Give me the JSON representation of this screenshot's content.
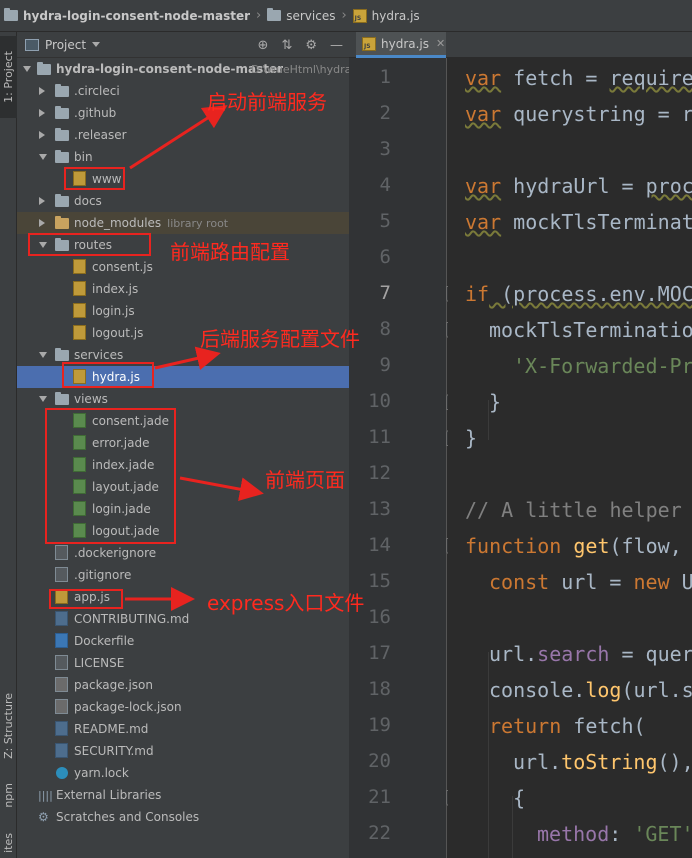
{
  "navbar": {
    "project": "hydra-login-consent-node-master",
    "folder": "services",
    "file": "hydra.js"
  },
  "left_strip": {
    "project_tab": "1: Project",
    "structure_tab": "Z: Structure",
    "npm_tab": "npm",
    "favorites_tab": "ites"
  },
  "project_panel": {
    "title": "Project"
  },
  "tree": {
    "root": {
      "name": "hydra-login-consent-node-master",
      "path": "D:\\wueHtml\\hydra-"
    },
    "circleci": ".circleci",
    "github": ".github",
    "releaser": ".releaser",
    "bin": "bin",
    "www": "www",
    "docs": "docs",
    "node_modules": "node_modules",
    "node_modules_note": "library root",
    "routes": "routes",
    "consent_js": "consent.js",
    "index_js": "index.js",
    "login_js": "login.js",
    "logout_js": "logout.js",
    "services": "services",
    "hydra_js": "hydra.js",
    "views": "views",
    "consent_jade": "consent.jade",
    "error_jade": "error.jade",
    "index_jade": "index.jade",
    "layout_jade": "layout.jade",
    "login_jade": "login.jade",
    "logout_jade": "logout.jade",
    "dockerignore": ".dockerignore",
    "gitignore": ".gitignore",
    "app_js": "app.js",
    "contributing": "CONTRIBUTING.md",
    "dockerfile": "Dockerfile",
    "license": "LICENSE",
    "package_json": "package.json",
    "package_lock": "package-lock.json",
    "readme": "README.md",
    "security": "SECURITY.md",
    "yarn_lock": "yarn.lock",
    "external_libraries": "External Libraries",
    "scratches": "Scratches and Consoles"
  },
  "editor": {
    "tab_label": "hydra.js",
    "line_numbers": [
      "1",
      "2",
      "3",
      "4",
      "5",
      "6",
      "7",
      "8",
      "9",
      "10",
      "11",
      "12",
      "13",
      "14",
      "15",
      "16",
      "17",
      "18",
      "19",
      "20",
      "21",
      "22"
    ],
    "code": {
      "l1_kw": "var",
      "l1_rest": " fetch = ",
      "l1_req": "require",
      "l2_kw": "var",
      "l2_rest": " querystring = r",
      "l4_kw": "var",
      "l4_rest": " hydraUrl = ",
      "l4_proc": "proc",
      "l5_kw": "var",
      "l5_rest": " mockTlsTerminat",
      "l7_kw": "if",
      "l7_rest": " (process.env.MOC",
      "l8": "mockTlsTerminatio",
      "l9": "'X-Forwarded-Pr",
      "l10": "}",
      "l11": "}",
      "l13": "// A little helper",
      "l14_kw": "function",
      "l14_fn": " get",
      "l14_rest": "(flow,",
      "l15_kw": "const",
      "l15_rest": " url = ",
      "l15_new": "new",
      "l15_tail": " U",
      "l17_a": "url.",
      "l17_prop": "search",
      "l17_b": " = quer",
      "l18_a": "console.",
      "l18_fn": "log",
      "l18_b": "(url.s",
      "l19_kw": "return",
      "l19_rest": " fetch(",
      "l20_a": "url.",
      "l20_fn": "toString",
      "l20_b": "(),",
      "l21": "{",
      "l22_prop": "method",
      "l22_b": ": ",
      "l22_str": "'GET'"
    }
  },
  "annotations": {
    "start_frontend": "启动前端服务",
    "frontend_routes": "前端路由配置",
    "backend_config": "后端服务配置文件",
    "frontend_pages": "前端页面",
    "express_entry": "express入口文件"
  },
  "colors": {
    "annotation": "#e8231f",
    "selection": "#4b6eaf",
    "keyword": "#cc7832"
  }
}
